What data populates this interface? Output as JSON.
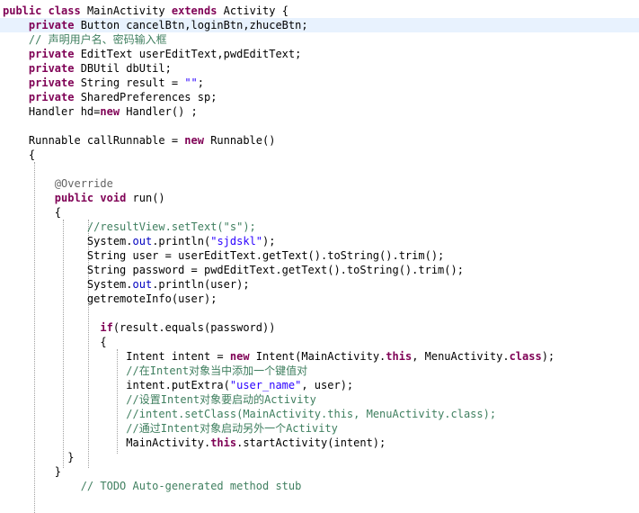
{
  "editor": {
    "lines": [
      {
        "tokens": [
          {
            "t": "kw",
            "v": "public"
          },
          {
            "t": "plain",
            "v": " "
          },
          {
            "t": "kw",
            "v": "class"
          },
          {
            "t": "plain",
            "v": " MainActivity "
          },
          {
            "t": "kw",
            "v": "extends"
          },
          {
            "t": "plain",
            "v": " Activity {"
          }
        ]
      },
      {
        "tokens": [
          {
            "t": "plain",
            "v": "    "
          },
          {
            "t": "kw",
            "v": "private"
          },
          {
            "t": "plain",
            "v": " Button cancelBtn,loginBtn,zhuceBtn;"
          }
        ]
      },
      {
        "tokens": [
          {
            "t": "plain",
            "v": "    "
          },
          {
            "t": "cm",
            "v": "// 声明用户名、密码输入框"
          }
        ]
      },
      {
        "tokens": [
          {
            "t": "plain",
            "v": "    "
          },
          {
            "t": "kw",
            "v": "private"
          },
          {
            "t": "plain",
            "v": " EditText userEditText,pwdEditText;"
          }
        ]
      },
      {
        "tokens": [
          {
            "t": "plain",
            "v": "    "
          },
          {
            "t": "kw",
            "v": "private"
          },
          {
            "t": "plain",
            "v": " DBUtil dbUtil;"
          }
        ]
      },
      {
        "tokens": [
          {
            "t": "plain",
            "v": "    "
          },
          {
            "t": "kw",
            "v": "private"
          },
          {
            "t": "plain",
            "v": " String result = "
          },
          {
            "t": "str",
            "v": "\"\""
          },
          {
            "t": "plain",
            "v": ";"
          }
        ]
      },
      {
        "tokens": [
          {
            "t": "plain",
            "v": "    "
          },
          {
            "t": "kw",
            "v": "private"
          },
          {
            "t": "plain",
            "v": " SharedPreferences sp;"
          }
        ]
      },
      {
        "tokens": [
          {
            "t": "plain",
            "v": "    Handler hd="
          },
          {
            "t": "kw",
            "v": "new"
          },
          {
            "t": "plain",
            "v": " Handler() ;"
          }
        ]
      },
      {
        "tokens": []
      },
      {
        "tokens": [
          {
            "t": "plain",
            "v": "    Runnable callRunnable = "
          },
          {
            "t": "kw",
            "v": "new"
          },
          {
            "t": "plain",
            "v": " Runnable()"
          }
        ]
      },
      {
        "tokens": [
          {
            "t": "plain",
            "v": "    {"
          }
        ]
      },
      {
        "tokens": []
      },
      {
        "tokens": [
          {
            "t": "plain",
            "v": "        "
          },
          {
            "t": "ann",
            "v": "@Override"
          }
        ]
      },
      {
        "tokens": [
          {
            "t": "plain",
            "v": "        "
          },
          {
            "t": "kw",
            "v": "public"
          },
          {
            "t": "plain",
            "v": " "
          },
          {
            "t": "kw",
            "v": "void"
          },
          {
            "t": "plain",
            "v": " run()"
          }
        ]
      },
      {
        "tokens": [
          {
            "t": "plain",
            "v": "        {"
          }
        ]
      },
      {
        "tokens": [
          {
            "t": "plain",
            "v": "             "
          },
          {
            "t": "cm",
            "v": "//resultView.setText(\"s\");"
          }
        ]
      },
      {
        "tokens": [
          {
            "t": "plain",
            "v": "             System."
          },
          {
            "t": "fld",
            "v": "out"
          },
          {
            "t": "plain",
            "v": ".println("
          },
          {
            "t": "str",
            "v": "\"sjdskl\""
          },
          {
            "t": "plain",
            "v": ");"
          }
        ]
      },
      {
        "tokens": [
          {
            "t": "plain",
            "v": "             String user = userEditText.getText().toString().trim();"
          }
        ]
      },
      {
        "tokens": [
          {
            "t": "plain",
            "v": "             String password = pwdEditText.getText().toString().trim();"
          }
        ]
      },
      {
        "tokens": [
          {
            "t": "plain",
            "v": "             System."
          },
          {
            "t": "fld",
            "v": "out"
          },
          {
            "t": "plain",
            "v": ".println(user);"
          }
        ]
      },
      {
        "tokens": [
          {
            "t": "plain",
            "v": "             getremoteInfo(user);"
          }
        ]
      },
      {
        "tokens": []
      },
      {
        "tokens": [
          {
            "t": "plain",
            "v": "               "
          },
          {
            "t": "kw",
            "v": "if"
          },
          {
            "t": "plain",
            "v": "(result.equals(password))"
          }
        ]
      },
      {
        "tokens": [
          {
            "t": "plain",
            "v": "               {"
          }
        ]
      },
      {
        "tokens": [
          {
            "t": "plain",
            "v": "                   Intent intent = "
          },
          {
            "t": "kw",
            "v": "new"
          },
          {
            "t": "plain",
            "v": " Intent(MainActivity."
          },
          {
            "t": "kw",
            "v": "this"
          },
          {
            "t": "plain",
            "v": ", MenuActivity."
          },
          {
            "t": "sc",
            "v": "class"
          },
          {
            "t": "plain",
            "v": ");"
          }
        ]
      },
      {
        "tokens": [
          {
            "t": "plain",
            "v": "                   "
          },
          {
            "t": "cm",
            "v": "//在Intent对象当中添加一个键值对"
          }
        ]
      },
      {
        "tokens": [
          {
            "t": "plain",
            "v": "                   intent.putExtra("
          },
          {
            "t": "str",
            "v": "\"user_name\""
          },
          {
            "t": "plain",
            "v": ", user);"
          }
        ]
      },
      {
        "tokens": [
          {
            "t": "plain",
            "v": "                   "
          },
          {
            "t": "cm",
            "v": "//设置Intent对象要启动的Activity"
          }
        ]
      },
      {
        "tokens": [
          {
            "t": "plain",
            "v": "                   "
          },
          {
            "t": "cm",
            "v": "//intent.setClass(MainActivity.this, MenuActivity.class);"
          }
        ]
      },
      {
        "tokens": [
          {
            "t": "plain",
            "v": "                   "
          },
          {
            "t": "cm",
            "v": "//通过Intent对象启动另外一个Activity"
          }
        ]
      },
      {
        "tokens": [
          {
            "t": "plain",
            "v": "                   MainActivity."
          },
          {
            "t": "kw",
            "v": "this"
          },
          {
            "t": "plain",
            "v": ".startActivity(intent);"
          }
        ]
      },
      {
        "tokens": [
          {
            "t": "plain",
            "v": "          }"
          }
        ]
      },
      {
        "tokens": [
          {
            "t": "plain",
            "v": "        }"
          }
        ]
      },
      {
        "tokens": [
          {
            "t": "plain",
            "v": "            "
          },
          {
            "t": "cm",
            "v": "// TODO Auto-generated method stub"
          }
        ]
      }
    ],
    "highlighted_line": 1
  },
  "colors": {
    "keyword": "#7f0055",
    "string": "#2a00ff",
    "comment": "#3f7f5f",
    "field": "#0000c0",
    "annotation": "#646464",
    "current_line": "#e8f2fe"
  }
}
